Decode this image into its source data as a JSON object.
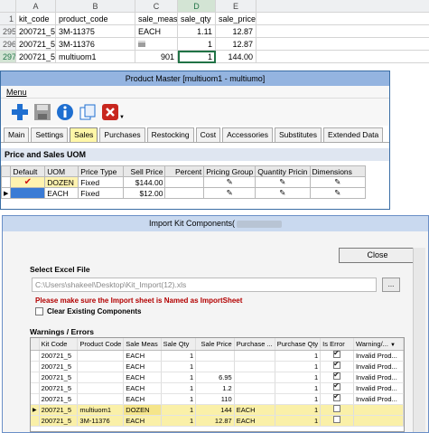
{
  "sheet": {
    "col_headers": [
      "A",
      "B",
      "C",
      "D",
      "E"
    ],
    "row_header_1": "1",
    "header_row": [
      "kit_code",
      "product_code",
      "sale_meas",
      "sale_qty",
      "sale_price"
    ],
    "rows": [
      {
        "num": "295",
        "a": "200721_5",
        "b": "3M-11375",
        "c": "EACH",
        "d": "1.11",
        "e": "12.87",
        "extra": ""
      },
      {
        "num": "296",
        "a": "200721_5",
        "b": "3M-11376",
        "c": "iiii",
        "d": "1",
        "e": "12.87",
        "extra": ""
      },
      {
        "num": "297",
        "a": "200721_5",
        "b": "multiuom1",
        "c": "901",
        "d": "1",
        "e": "144.00",
        "extra": ""
      }
    ]
  },
  "pm": {
    "title": "Product Master [multiuom1 - multiumo]",
    "menu": "Menu",
    "tabs": [
      "Main",
      "Settings",
      "Sales",
      "Purchases",
      "Restocking",
      "Cost",
      "Accessories",
      "Substitutes",
      "Extended Data"
    ],
    "section": "Price and Sales UOM",
    "grid_headers": [
      "Default",
      "UOM",
      "Price Type",
      "Sell Price",
      "Percent",
      "Pricing Group",
      "Quantity Pricin",
      "Dimensions"
    ],
    "grid_rows": [
      {
        "uom": "DOZEN",
        "type": "Fixed",
        "price": "$144.00"
      },
      {
        "uom": "EACH",
        "type": "Fixed",
        "price": "$12.00"
      }
    ]
  },
  "ik": {
    "title": "Import Kit Components(",
    "close": "Close",
    "select_label": "Select Excel File",
    "file_path": "C:\\Users\\shakeel\\Desktop\\Kit_Import(12).xls",
    "browse": "...",
    "warning": "Please make sure the Import sheet is Named as ImportSheet",
    "clear_label": "Clear Existing Components",
    "we_label": "Warnings / Errors",
    "headers": [
      "Kit Code",
      "Product Code",
      "Sale Meas",
      "Sale Qty",
      "Sale Price",
      "Purchase ...",
      "Purchase Qty",
      "Is Error",
      "Warning/..."
    ],
    "rows": [
      {
        "kit": "200721_5",
        "prod": "",
        "meas": "EACH",
        "qty": "1",
        "price": "",
        "pm": "",
        "pq": "1",
        "err": true,
        "warn": "Invalid Prod..."
      },
      {
        "kit": "200721_5",
        "prod": "",
        "meas": "EACH",
        "qty": "1",
        "price": "",
        "pm": "",
        "pq": "1",
        "err": true,
        "warn": "Invalid Prod..."
      },
      {
        "kit": "200721_5",
        "prod": "",
        "meas": "EACH",
        "qty": "1",
        "price": "6.95",
        "pm": "",
        "pq": "1",
        "err": true,
        "warn": "Invalid Prod..."
      },
      {
        "kit": "200721_5",
        "prod": "",
        "meas": "EACH",
        "qty": "1",
        "price": "1.2",
        "pm": "",
        "pq": "1",
        "err": true,
        "warn": "Invalid Prod..."
      },
      {
        "kit": "200721_5",
        "prod": "",
        "meas": "EACH",
        "qty": "1",
        "price": "110",
        "pm": "",
        "pq": "1",
        "err": true,
        "warn": "Invalid Prod..."
      },
      {
        "kit": "200721_5",
        "prod": "multiuom1",
        "meas": "DOZEN",
        "qty": "1",
        "price": "144",
        "pm": "EACH",
        "pq": "1",
        "err": false,
        "warn": ""
      },
      {
        "kit": "200721_5",
        "prod": "3M-11376",
        "meas": "EACH",
        "qty": "1",
        "price": "12.87",
        "pm": "EACH",
        "pq": "1",
        "err": false,
        "warn": ""
      }
    ]
  }
}
